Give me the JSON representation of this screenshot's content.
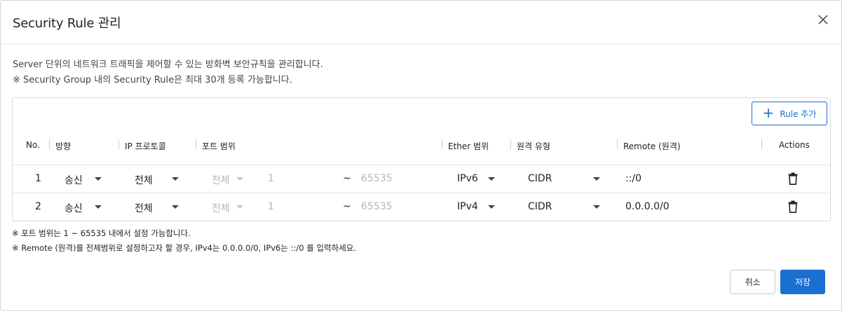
{
  "dialog": {
    "title": "Security Rule 관리",
    "close_icon": "close-icon",
    "description_line1": "Server 단위의 네트워크 트래픽을 제어할 수 있는 방화벽 보안규칙을 관리합니다.",
    "description_line2": "※ Security Group 내의 Security Rule은 최대 30개 등록 가능합니다."
  },
  "toolbar": {
    "add_rule_icon": "plus-icon",
    "add_rule_label": "Rule 추가"
  },
  "table": {
    "headers": {
      "no": "No.",
      "direction": "방향",
      "protocol": "IP 프로토콜",
      "port_range": "포트 범위",
      "ether": "Ether 범위",
      "remote_type": "원격 유형",
      "remote": "Remote (원격)",
      "actions": "Actions"
    },
    "rows": [
      {
        "no": "1",
        "direction": "송신",
        "protocol": "전체",
        "port_select": "전체",
        "port_from": "1",
        "tilde": "~",
        "port_to": "65535",
        "ether": "IPv6",
        "remote_type": "CIDR",
        "remote": "::/0",
        "delete_icon": "trash-icon"
      },
      {
        "no": "2",
        "direction": "송신",
        "protocol": "전체",
        "port_select": "전체",
        "port_from": "1",
        "tilde": "~",
        "port_to": "65535",
        "ether": "IPv4",
        "remote_type": "CIDR",
        "remote": "0.0.0.0/0",
        "delete_icon": "trash-icon"
      }
    ]
  },
  "notes": {
    "line1": "※ 포트 범위는 1 ~ 65535 내에서 설정 가능합니다.",
    "line2": "※ Remote (원격)를 전체범위로 설정하고자 할 경우, IPv4는 0.0.0.0/0, IPv6는 ::/0 를 입력하세요."
  },
  "footer": {
    "cancel_label": "취소",
    "save_label": "저장"
  },
  "colors": {
    "accent": "#1a6fd1",
    "border": "#d6d9dd",
    "muted_text": "#b3b6ba"
  }
}
